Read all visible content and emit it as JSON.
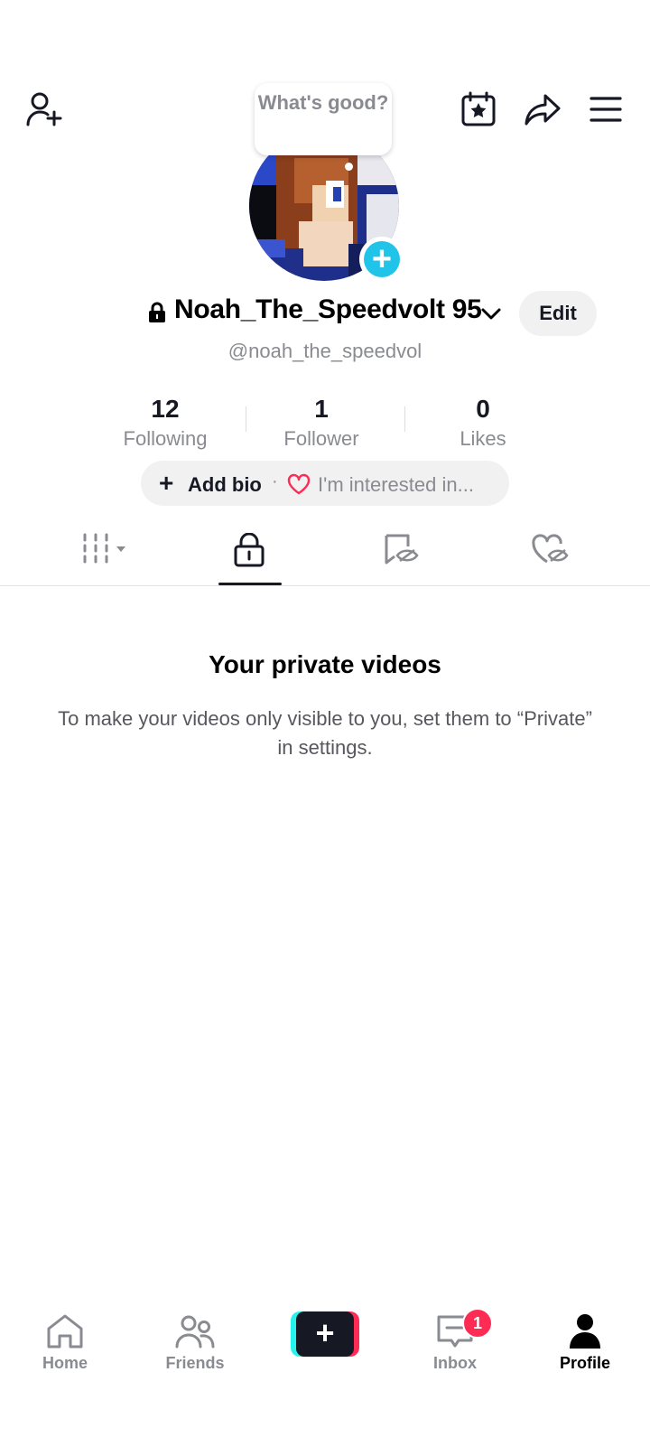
{
  "header": {
    "icons": [
      "add-friend-icon",
      "calendar-star-icon",
      "share-icon",
      "menu-icon"
    ]
  },
  "note": {
    "text": "What's good?"
  },
  "profile": {
    "username": "Noah_The_Speedvolt 95",
    "handle": "@noah_the_speedvol",
    "edit_label": "Edit",
    "avatar_plus": "+"
  },
  "stats": {
    "following": {
      "value": "12",
      "label": "Following"
    },
    "follower": {
      "value": "1",
      "label": "Follower"
    },
    "likes": {
      "value": "0",
      "label": "Likes"
    }
  },
  "bio": {
    "add_label": "Add bio",
    "separator": "·",
    "interest_label": "I'm interested in..."
  },
  "tabs": [
    "videos-grid",
    "private",
    "reposts",
    "liked"
  ],
  "empty_state": {
    "title": "Your private videos",
    "body": "To make your videos only visible to you, set them to “Private” in settings."
  },
  "bottom_nav": {
    "home": "Home",
    "friends": "Friends",
    "create": "+",
    "inbox": "Inbox",
    "inbox_badge": "1",
    "profile": "Profile"
  },
  "colors": {
    "accent_cyan": "#20c4e9",
    "badge_red": "#fe2c55",
    "text_gray": "#8a8b91"
  }
}
